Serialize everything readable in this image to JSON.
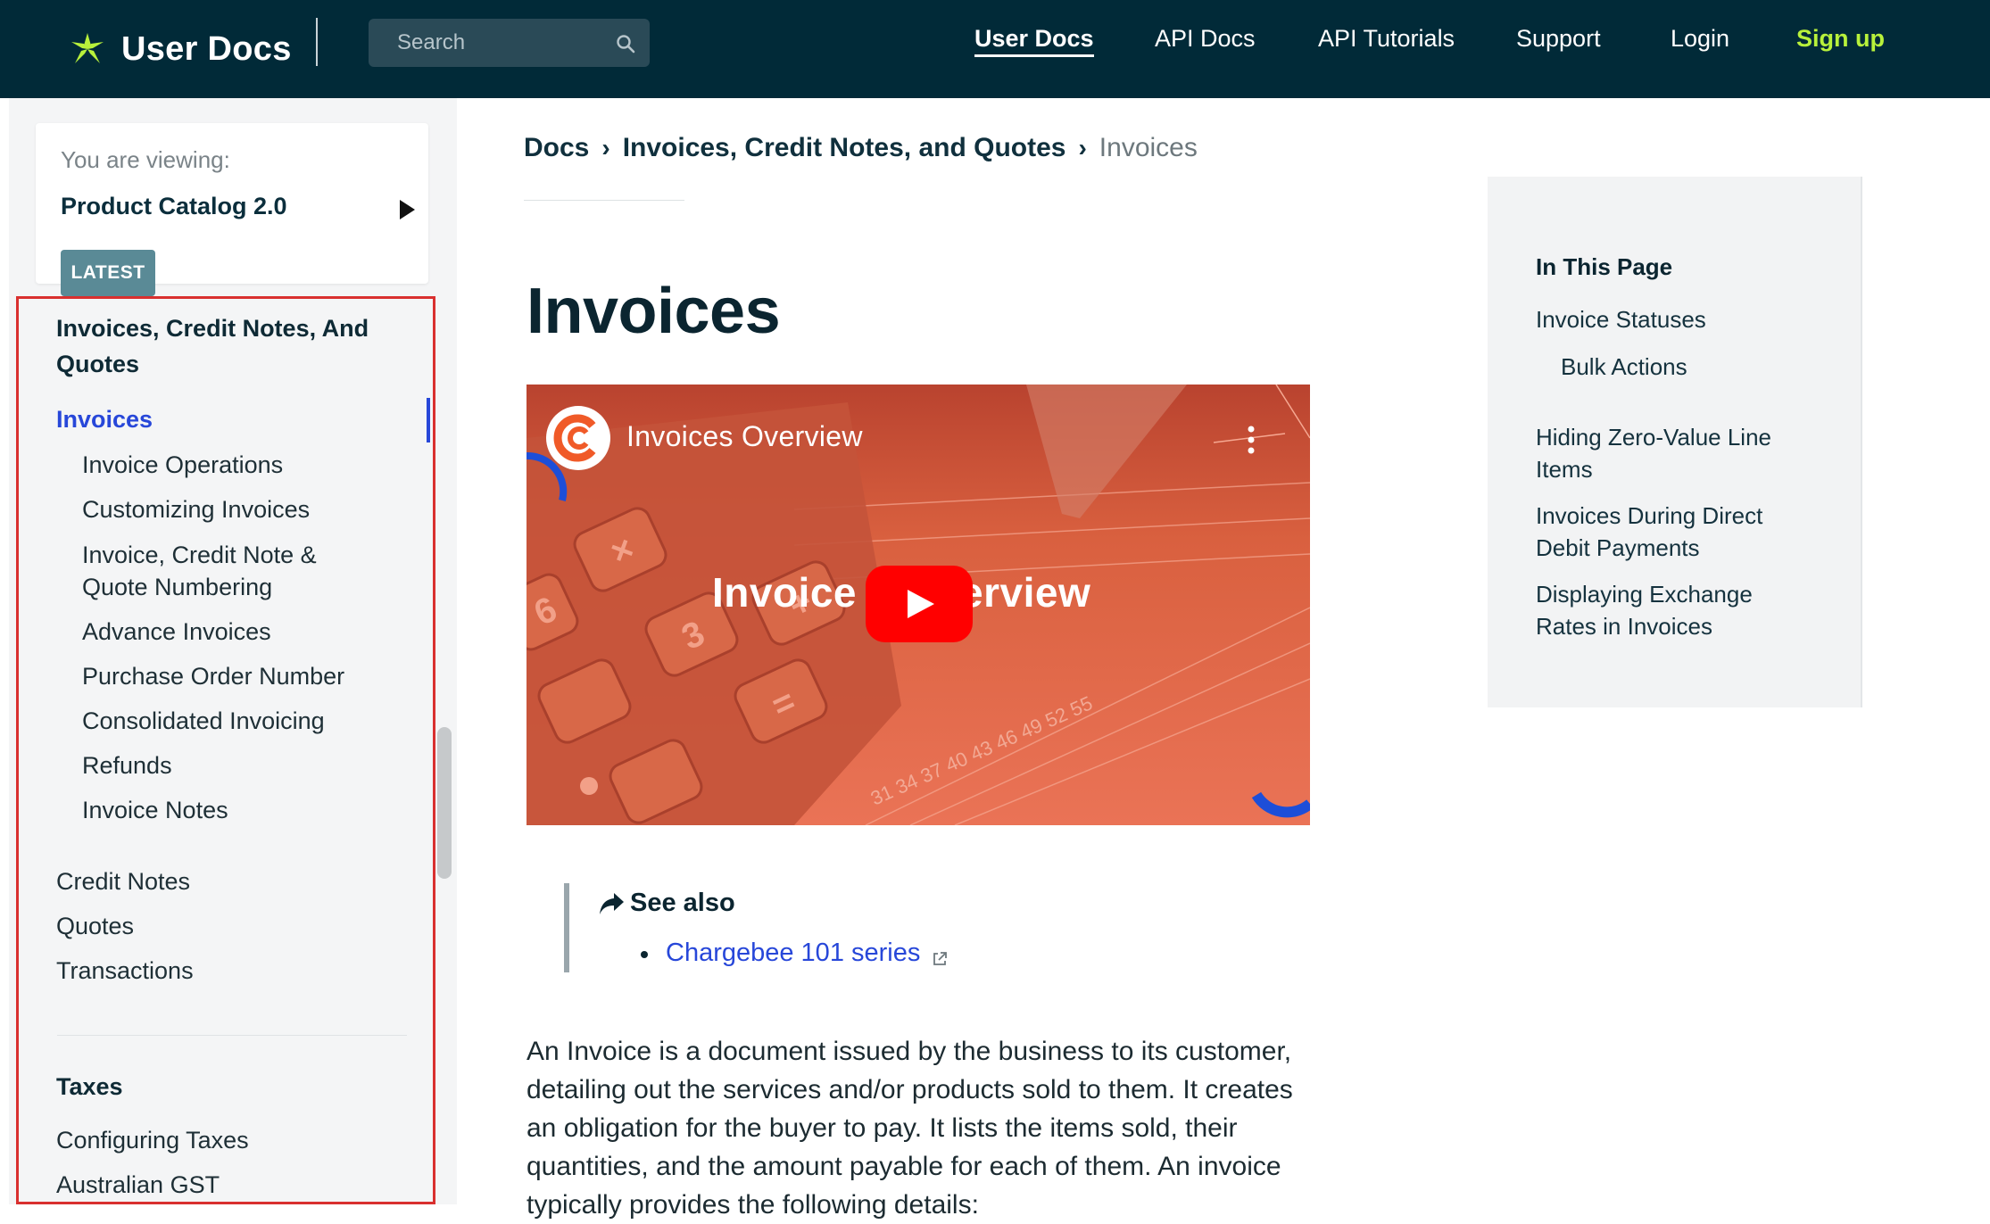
{
  "header": {
    "brand": "User Docs",
    "search_placeholder": "Search",
    "nav": [
      {
        "label": "User Docs",
        "active": true
      },
      {
        "label": "API Docs"
      },
      {
        "label": "API Tutorials"
      },
      {
        "label": "Support"
      },
      {
        "label": "Login"
      },
      {
        "label": "Sign up"
      }
    ],
    "colors": {
      "bar": "#012a38",
      "accent": "#b8f13b"
    }
  },
  "sidebar": {
    "viewing_label": "You are viewing:",
    "viewing_value": "Product Catalog 2.0",
    "badge": "LATEST",
    "section_heading": "Invoices, Credit Notes, And Quotes",
    "active_item": "Invoices",
    "sub_items": [
      "Invoice Operations",
      "Customizing Invoices",
      "Invoice, Credit Note &",
      "Quote Numbering",
      "Advance Invoices",
      "Purchase Order Number",
      "Consolidated Invoicing",
      "Refunds",
      "Invoice Notes"
    ],
    "items": [
      "Credit Notes",
      "Quotes",
      "Transactions"
    ],
    "taxes_heading": "Taxes",
    "tax_items": [
      "Configuring Taxes",
      "Australian GST"
    ]
  },
  "breadcrumb": {
    "items": [
      "Docs",
      "Invoices, Credit Notes, and Quotes"
    ],
    "current": "Invoices",
    "separator": "›"
  },
  "page": {
    "title": "Invoices",
    "video": {
      "title": "Invoices Overview",
      "caption_left": "Invoice",
      "caption_right": "erview"
    },
    "see_also": {
      "title": "See also",
      "link": "Chargebee 101 series"
    },
    "paragraph": "An Invoice is a document issued by the business to its customer, detailing out the services and/or products sold to them. It creates an obligation for the buyer to pay. It lists the items sold, their quantities, and the amount payable for each of them. An invoice typically provides the following details:"
  },
  "toc": {
    "heading": "In This Page",
    "items": [
      "Invoice Statuses",
      "Bulk Actions",
      "Hiding Zero-Value Line Items",
      "Invoices During Direct Debit Payments",
      "Displaying Exchange Rates in Invoices"
    ]
  }
}
